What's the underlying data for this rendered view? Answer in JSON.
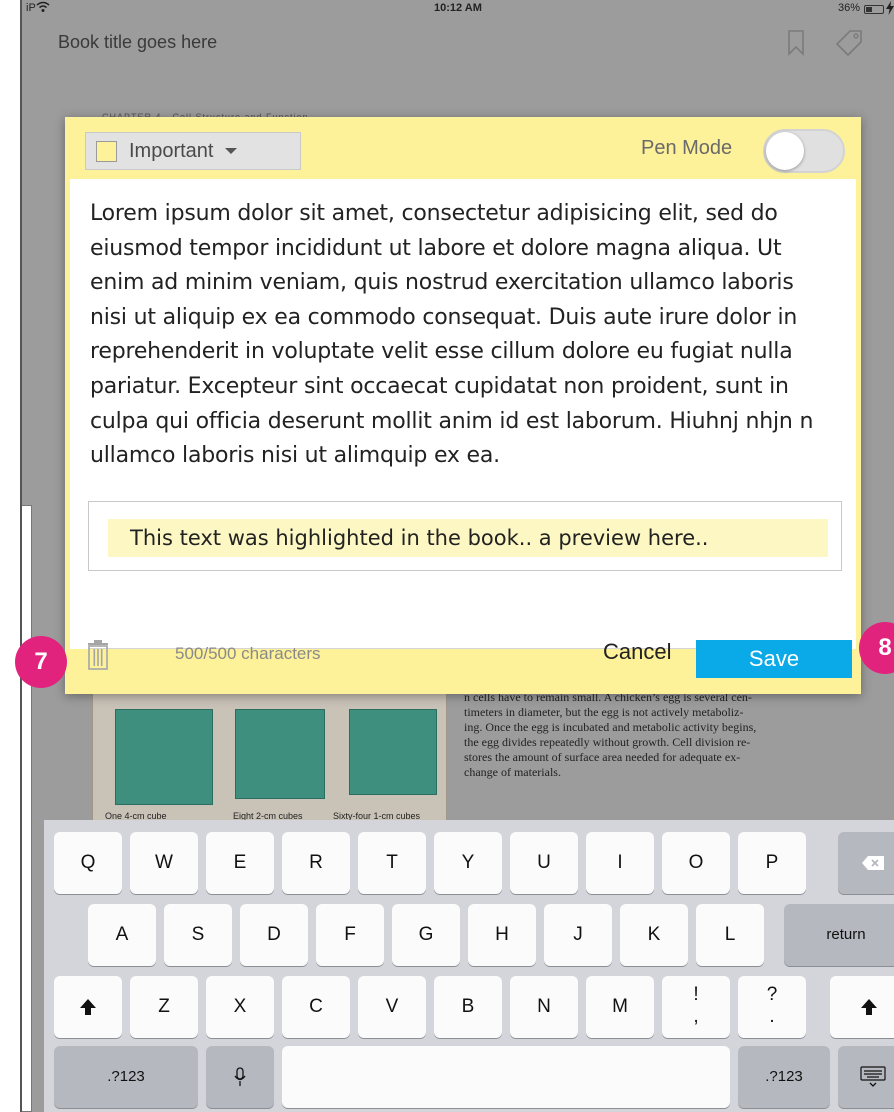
{
  "status_bar": {
    "carrier": "iP",
    "time": "10:12 AM",
    "battery": "36%"
  },
  "book": {
    "title": "Book title goes here",
    "page_header": "CHAPTER 4 · Cell Structure and Function",
    "figure_labels": [
      "One 4-cm cube",
      "Eight 2-cm cubes",
      "Sixty-four 1-cm cubes"
    ],
    "text_lines": [
      "n cells have to remain small. A chicken’s egg is several cen-",
      "timeters in diameter, but the egg is not actively metaboliz-",
      "ing. Once the egg is incubated and metabolic activity begins,",
      "the egg divides repeatedly without growth. Cell division re-",
      "stores the amount of surface area needed for adequate ex-",
      "change of materials."
    ]
  },
  "note_dialog": {
    "tag": {
      "label": "Important",
      "color": "#fdf199"
    },
    "pen_mode_label": "Pen Mode",
    "pen_mode_on": false,
    "note_text": "Lorem ipsum dolor sit amet, consectetur adipisicing elit, sed do eiusmod tempor incididunt ut labore et dolore magna aliqua. Ut enim ad minim veniam, quis nostrud exercitation ullamco laboris nisi ut aliquip ex ea commodo consequat. Duis aute irure dolor in reprehenderit in voluptate velit esse cillum dolore eu fugiat nulla pariatur. Excepteur sint occaecat cupidatat non proident, sunt in culpa qui officia deserunt mollit anim id est laborum. Hiuhnj nhjn n ullamco laboris nisi ut alimquip ex ea.",
    "highlight_preview": "This text was highlighted in the book.. a preview here..",
    "char_count": "500/500 characters",
    "cancel_label": "Cancel",
    "save_label": "Save",
    "accent_color": "#0aa9e8"
  },
  "callouts": [
    "7",
    "8"
  ],
  "keyboard": {
    "row1": [
      "Q",
      "W",
      "E",
      "R",
      "T",
      "Y",
      "U",
      "I",
      "O",
      "P"
    ],
    "row2": [
      "A",
      "S",
      "D",
      "F",
      "G",
      "H",
      "J",
      "K",
      "L"
    ],
    "row3": [
      "Z",
      "X",
      "C",
      "V",
      "B",
      "N",
      "M",
      "!\n,",
      "?\n."
    ],
    "return_label": "return",
    "numbers_label": ".?123",
    "backspace_icon": "backspace-icon",
    "shift_icon": "shift-icon",
    "mic_icon": "microphone-icon",
    "hide_icon": "keyboard-hide-icon"
  }
}
